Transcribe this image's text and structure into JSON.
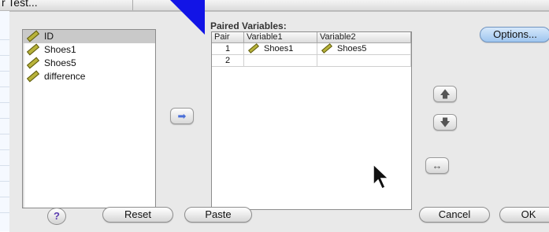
{
  "window": {
    "title": "r Test..."
  },
  "source_variables": [
    {
      "name": "ID",
      "selected": true
    },
    {
      "name": "Shoes1",
      "selected": false
    },
    {
      "name": "Shoes5",
      "selected": false
    },
    {
      "name": "difference",
      "selected": false
    }
  ],
  "paired": {
    "label": "Paired Variables:",
    "columns": [
      "Pair",
      "Variable1",
      "Variable2"
    ],
    "rows": [
      {
        "pair": "1",
        "var1": "Shoes1",
        "var2": "Shoes5"
      },
      {
        "pair": "2",
        "var1": "",
        "var2": ""
      }
    ]
  },
  "buttons": {
    "options": "Options...",
    "help": "?",
    "reset": "Reset",
    "paste": "Paste",
    "cancel": "Cancel",
    "ok": "OK"
  },
  "icons": {
    "move_in": "right-arrow-icon",
    "move_up": "up-arrow-icon",
    "move_down": "down-arrow-icon",
    "swap": "swap-icon"
  },
  "colors": {
    "pointer": "#1214e6",
    "options_button": "#b8d6f5",
    "selection": "#c9c9c9"
  }
}
